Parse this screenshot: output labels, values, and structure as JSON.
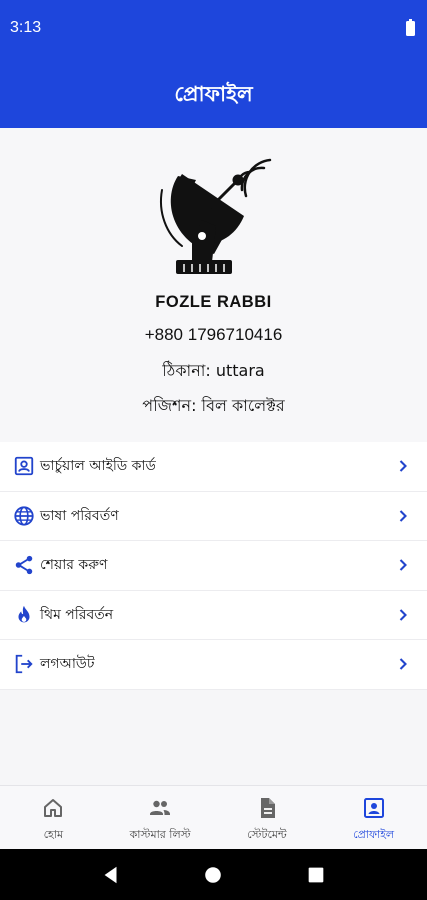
{
  "status_bar": {
    "time": "3:13"
  },
  "app_bar": {
    "title": "প্রোফাইল"
  },
  "profile": {
    "logo_icon": "satellite-dish-icon",
    "name": "FOZLE RABBI",
    "phone": "+880 1796710416",
    "address": "ঠিকানা: uttara",
    "position": "পজিশন: বিল কালেক্টর"
  },
  "menu": {
    "items": [
      {
        "label": "ভার্চুয়াল আইডি কার্ড",
        "icon": "id-card-icon"
      },
      {
        "label": "ভাষা পরিবর্তণ",
        "icon": "globe-icon"
      },
      {
        "label": "শেয়ার করুণ",
        "icon": "share-icon"
      },
      {
        "label": "থিম পরিবর্তন",
        "icon": "flame-icon"
      },
      {
        "label": "লগআউট",
        "icon": "logout-icon"
      }
    ]
  },
  "bottom_nav": {
    "items": [
      {
        "label": "হোম",
        "icon": "home-icon",
        "active": false
      },
      {
        "label": "কাস্টমার লিস্ট",
        "icon": "people-icon",
        "active": false
      },
      {
        "label": "স্টেটমেন্ট",
        "icon": "document-icon",
        "active": false
      },
      {
        "label": "প্রোফাইল",
        "icon": "profile-icon",
        "active": true
      }
    ]
  },
  "colors": {
    "primary": "#1e46dc",
    "accent": "#2244cc",
    "background": "#f6f6f8"
  }
}
